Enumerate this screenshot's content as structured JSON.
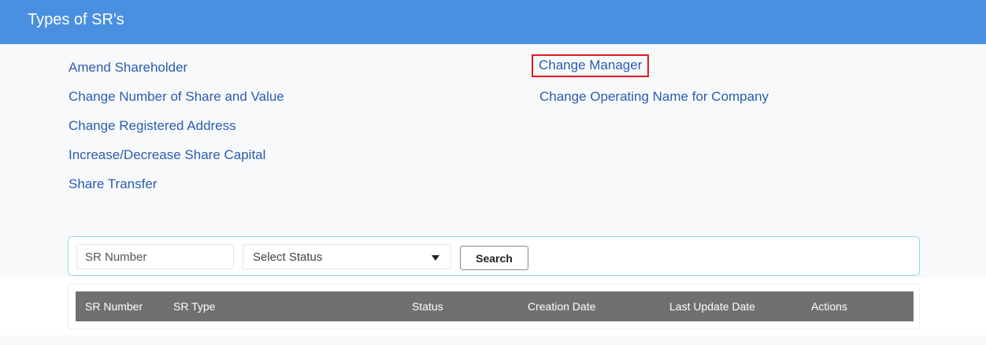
{
  "header": {
    "title": "Types of SR's"
  },
  "sr_types": {
    "left": [
      "Amend Shareholder",
      "Change Number of Share and Value",
      "Change Registered Address",
      "Increase/Decrease Share Capital",
      "Share Transfer"
    ],
    "right": [
      "Change Manager",
      "Change Operating Name for Company"
    ],
    "highlighted": "Change Manager",
    "highlight_color": "#e01b24",
    "link_color": "#2a5db0"
  },
  "search": {
    "sr_number_placeholder": "SR Number",
    "status_selected": "Select Status",
    "search_label": "Search"
  },
  "table": {
    "columns": [
      "SR Number",
      "SR Type",
      "Status",
      "Creation Date",
      "Last Update Date",
      "Actions"
    ],
    "header_color": "#707070"
  },
  "colors": {
    "header_bg": "#4a90e0",
    "search_border": "#8fd6e6"
  }
}
